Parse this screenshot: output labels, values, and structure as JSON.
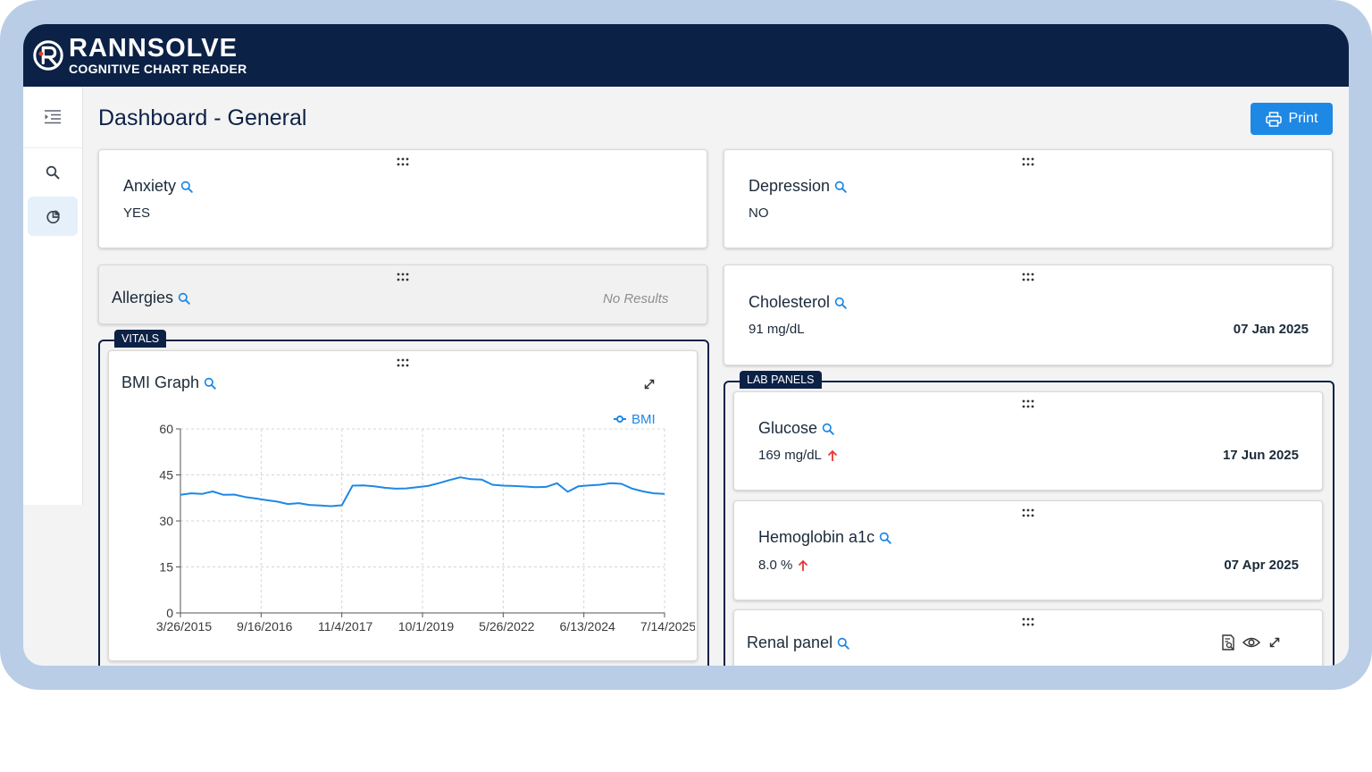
{
  "app": {
    "brand_name": "RANNSOLVE",
    "brand_tagline": "COGNITIVE CHART READER"
  },
  "sidebar": {
    "items": [
      {
        "icon": "menu-indent-icon",
        "active": false
      },
      {
        "icon": "search-icon",
        "active": false
      },
      {
        "icon": "pie-chart-icon",
        "active": true
      }
    ]
  },
  "header": {
    "title": "Dashboard - General",
    "print_label": "Print"
  },
  "cards": {
    "anxiety": {
      "title": "Anxiety",
      "value": "YES"
    },
    "depression": {
      "title": "Depression",
      "value": "NO"
    },
    "allergies": {
      "title": "Allergies",
      "status": "No Results"
    },
    "cholesterol": {
      "title": "Cholesterol",
      "value": "91 mg/dL",
      "date": "07 Jan 2025"
    },
    "glucose": {
      "title": "Glucose",
      "value": "169 mg/dL",
      "date": "17 Jun 2025",
      "flag": "high"
    },
    "hba1c": {
      "title": "Hemoglobin a1c",
      "value": "8.0 %",
      "date": "07 Apr 2025",
      "flag": "high"
    },
    "renal": {
      "title": "Renal panel"
    }
  },
  "groups": {
    "vitals": "VITALS",
    "lab_panels": "LAB PANELS"
  },
  "bmi_card": {
    "title": "BMI Graph"
  },
  "colors": {
    "navy": "#0c2146",
    "accent": "#1e88e5",
    "alert": "#e53935",
    "frame": "#b9cde6"
  },
  "chart_data": {
    "type": "line",
    "legend_position": "top-right",
    "grid": true,
    "ylim": [
      0,
      60
    ],
    "yticks": [
      0,
      15,
      30,
      45,
      60
    ],
    "xticks": [
      "3/26/2015",
      "9/16/2016",
      "11/4/2017",
      "10/1/2019",
      "5/26/2022",
      "6/13/2024",
      "7/14/2025"
    ],
    "series": [
      {
        "name": "BMI",
        "color": "#1e88e5",
        "values": [
          38.5,
          39.0,
          38.8,
          39.6,
          38.5,
          38.6,
          37.8,
          37.3,
          36.8,
          36.3,
          35.5,
          35.8,
          35.2,
          35.0,
          34.8,
          35.1,
          41.5,
          41.6,
          41.3,
          40.8,
          40.5,
          40.6,
          41.0,
          41.4,
          42.3,
          43.3,
          44.2,
          43.6,
          43.5,
          41.8,
          41.5,
          41.4,
          41.2,
          41.0,
          41.1,
          42.3,
          39.5,
          41.3,
          41.6,
          41.8,
          42.3,
          42.1,
          40.5,
          39.6,
          39.0,
          38.8
        ]
      }
    ]
  }
}
